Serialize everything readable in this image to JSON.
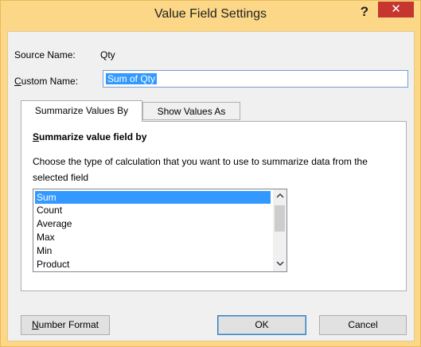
{
  "window": {
    "title": "Value Field Settings",
    "help_label": "?",
    "close_label": "✕"
  },
  "source": {
    "label": "Source Name:",
    "value": "Qty"
  },
  "custom_name": {
    "label_prefix": "C",
    "label_rest": "ustom Name:",
    "value": "Sum of Qty"
  },
  "tabs": [
    {
      "label": "Summarize Values By",
      "active": true
    },
    {
      "label": "Show Values As",
      "active": false
    }
  ],
  "panel": {
    "heading_prefix": "S",
    "heading_rest": "ummarize value field by",
    "description": "Choose the type of calculation that you want to use to summarize data from the selected field",
    "items": [
      "Sum",
      "Count",
      "Average",
      "Max",
      "Min",
      "Product"
    ],
    "selected": "Sum"
  },
  "scrollbar": {
    "up_icon": "chevron-up-icon",
    "down_icon": "chevron-down-icon"
  },
  "buttons": {
    "number_prefix": "N",
    "number_rest": "umber Format",
    "ok": "OK",
    "cancel": "Cancel"
  },
  "colors": {
    "titlebar": "#fbd787",
    "close": "#c7352f",
    "selection": "#3399ff"
  }
}
